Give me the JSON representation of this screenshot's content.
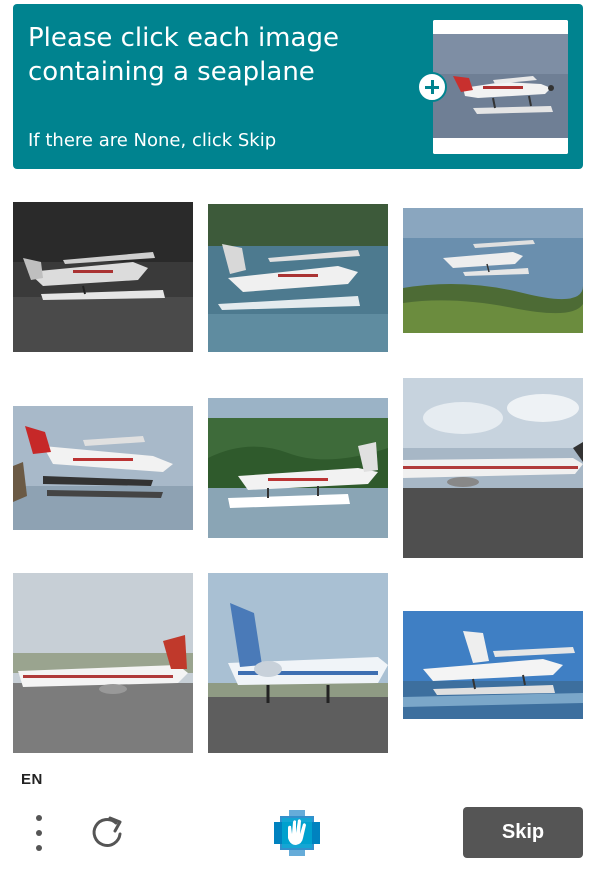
{
  "header": {
    "title": "Please click each image containing a seaplane",
    "subtitle": "If there are None, click Skip",
    "example_image": "seaplane-example",
    "accent_color": "#00838f"
  },
  "grid": {
    "tiles": [
      {
        "subject": "seaplane",
        "scene": "seaplane on dark water"
      },
      {
        "subject": "seaplane",
        "scene": "seaplane taking off from lake"
      },
      {
        "subject": "seaplane",
        "scene": "seaplane over water near coast"
      },
      {
        "subject": "seaplane",
        "scene": "seaplane landing on water"
      },
      {
        "subject": "seaplane",
        "scene": "seaplane floating near trees"
      },
      {
        "subject": "airliner",
        "scene": "airliner on runway"
      },
      {
        "subject": "airliner",
        "scene": "airliner with red tail on tarmac"
      },
      {
        "subject": "airliner",
        "scene": "blue tri-jet airliner on tarmac"
      },
      {
        "subject": "seaplane",
        "scene": "seaplane in flight over water"
      }
    ]
  },
  "footer": {
    "language": "EN",
    "menu_icon": "more-vertical-icon",
    "refresh_icon": "refresh-icon",
    "logo_icon": "hcaptcha-logo-icon",
    "skip_label": "Skip",
    "skip_color": "#555555"
  }
}
